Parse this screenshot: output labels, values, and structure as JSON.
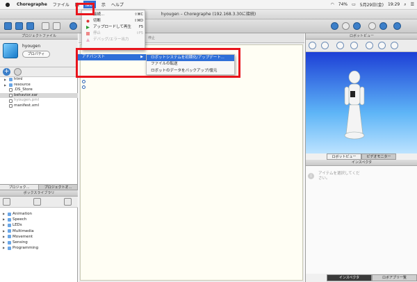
{
  "menubar": {
    "apple": "",
    "app_name": "Choregraphe",
    "items": [
      "ファイル",
      "編",
      "接続",
      "示",
      "ヘルプ"
    ],
    "status": {
      "battery": "74%",
      "date": "5月29日(金)",
      "time": "19:29"
    }
  },
  "window": {
    "title": "hyougen – Choregraphe (192.168.3.30に接続)"
  },
  "connect_menu": {
    "items": [
      {
        "label": "接続...",
        "shortcut": "⇧⌘C",
        "disabled": false
      },
      {
        "label": "切断",
        "shortcut": "⇧⌘D",
        "disabled": false
      },
      {
        "label": "アップロードして再生",
        "shortcut": "F5",
        "disabled": false
      },
      {
        "label": "停止",
        "shortcut": "⇧F5",
        "disabled": true
      },
      {
        "label": "デバッグ/エラー出力",
        "shortcut": "",
        "disabled": true
      }
    ],
    "advanced": "アドバンスト"
  },
  "advanced_submenu": [
    "ロボットシステムを初期化/アップデート...",
    "ファイルの転送",
    "ロボットのデータをバックアップ/復元"
  ],
  "left_panel": {
    "header": "プロジェクトファイル",
    "project_name": "hyougen",
    "properties_button": "プロパティ",
    "files": [
      {
        "name": "html",
        "type": "folder",
        "selected": false,
        "grey": false
      },
      {
        "name": "resource",
        "type": "folder",
        "selected": false,
        "grey": false
      },
      {
        "name": ".DS_Store",
        "type": "file",
        "selected": false,
        "grey": false
      },
      {
        "name": "behavior.xar",
        "type": "file",
        "selected": true,
        "grey": false
      },
      {
        "name": "hyougen.pml",
        "type": "file",
        "selected": false,
        "grey": true
      },
      {
        "name": "manifest.xml",
        "type": "file",
        "selected": false,
        "grey": false
      }
    ],
    "tabs": [
      "プロジェク...",
      "プロジェクトオ..."
    ],
    "box_library_header": "ボックスライブラリ",
    "box_categories": [
      "Animation",
      "Speech",
      "LEDs",
      "Multimedia",
      "Movement",
      "Sensing",
      "Programming"
    ]
  },
  "canvas": {
    "stop_label": "停止"
  },
  "right_panel": {
    "robot_view_header": "ロボットビュー",
    "view_tabs": [
      "ロボットビュー",
      "ビデオモニター"
    ],
    "inspector_header": "インスペクタ",
    "inspector_message": "アイテムを選択してください。",
    "bottom_tabs": [
      "インスペクタ",
      "ロボアプリ一覧"
    ]
  },
  "colors": {
    "highlight": "#2f6fd8",
    "annotation_red": "#e8141c"
  }
}
